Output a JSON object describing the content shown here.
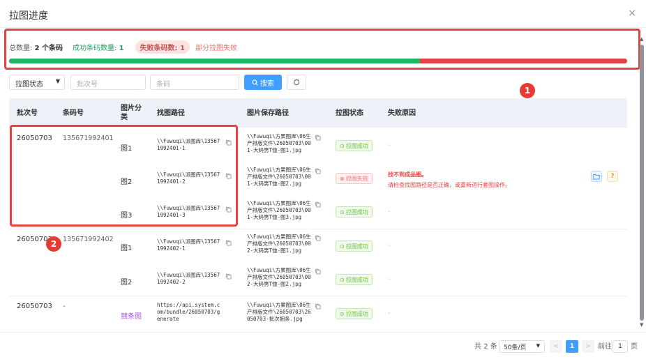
{
  "dialog": {
    "title": "拉图进度",
    "close": "×"
  },
  "summary": {
    "total_label": "总数量:",
    "total_value": "2 个条码",
    "success_label": "成功条码数量:",
    "success_value": "1",
    "fail_label": "失败条码数: 1",
    "partial": "部分拉图失败",
    "progress_percent": 66.5,
    "colors": {
      "success": "#21b562",
      "fail": "#e54343"
    }
  },
  "filters": {
    "status_select": "拉图状态",
    "batch_placeholder": "批次号",
    "barcode_placeholder": "条码",
    "search_label": "搜索",
    "search_icon": "search-icon",
    "refresh_icon": "refresh-icon"
  },
  "badges": {
    "one": "1",
    "two": "2"
  },
  "table": {
    "headers": [
      "批次号",
      "条码号",
      "图片分类",
      "找图路径",
      "图片保存路径",
      "拉图状态",
      "失败原因"
    ],
    "rows": [
      {
        "batch": "26050703",
        "barcode": "135671992401",
        "category": "图1",
        "find": [
          "\\\\Fuwuqi\\派图库\\13567",
          "1992401-1"
        ],
        "save": [
          "\\\\Fuwuqi\\方果图库\\06生",
          "产排版文件\\26050703\\00",
          "1-大码男T恤-图1.jpg"
        ],
        "status": "拉图成功",
        "reason": "-"
      },
      {
        "batch": "",
        "barcode": "",
        "category": "图2",
        "find": [
          "\\\\Fuwuqi\\派图库\\13567",
          "1992401-2"
        ],
        "save": [
          "\\\\Fuwuqi\\方果图库\\06生",
          "产排版文件\\26050703\\00",
          "1-大码男T恤-图2.jpg"
        ],
        "status": "拉图失败",
        "reason_title": "找不到成品图。",
        "reason_desc": "请检查找图路径是否正确，或重新进行套图操作。"
      },
      {
        "batch": "",
        "barcode": "",
        "category": "图3",
        "find": [
          "\\\\Fuwuqi\\派图库\\13567",
          "1992401-3"
        ],
        "save": [
          "\\\\Fuwuqi\\方果图库\\06生",
          "产排版文件\\26050703\\00",
          "1-大码男T恤-图3.jpg"
        ],
        "status": "拉图成功",
        "reason": "-"
      },
      {
        "batch": "26050703",
        "barcode": "135671992402",
        "category": "图1",
        "find": [
          "\\\\Fuwuqi\\派图库\\13567",
          "1992402-1"
        ],
        "save": [
          "\\\\Fuwuqi\\方果图库\\06生",
          "产排版文件\\26050703\\00",
          "2-大码男T恤-图1.jpg"
        ],
        "status": "拉图成功",
        "reason": "-"
      },
      {
        "batch": "",
        "barcode": "",
        "category": "图2",
        "find": [
          "\\\\Fuwuqi\\派图库\\13567",
          "1992402-2"
        ],
        "save": [
          "\\\\Fuwuqi\\方果图库\\06生",
          "产排版文件\\26050703\\00",
          "2-大码男T恤-图2.jpg"
        ],
        "status": "拉图成功",
        "reason": "-"
      },
      {
        "batch": "26050703",
        "barcode": "-",
        "category": "捆条图",
        "find": [
          "https://api.system.c",
          "om/bundle/26050703/g",
          "enerate"
        ],
        "save": [
          "\\\\Fuwuqi\\方果图库\\06生",
          "产排版文件\\26050703\\26",
          "050703-批次捆条.jpg"
        ],
        "status": "拉图成功",
        "reason": "-"
      }
    ]
  },
  "pagination": {
    "total": "共 2 条",
    "page_size": "50条/页",
    "current": "1",
    "goto_label": "前往",
    "goto_value": "1",
    "page_unit": "页",
    "prev": "<",
    "next": ">"
  }
}
